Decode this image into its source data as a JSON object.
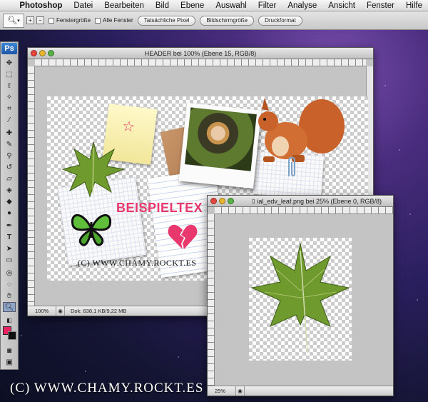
{
  "menubar": {
    "app_name": "Photoshop",
    "items": [
      "Datei",
      "Bearbeiten",
      "Bild",
      "Ebene",
      "Auswahl",
      "Filter",
      "Analyse",
      "Ansicht",
      "Fenster",
      "Hilfe"
    ]
  },
  "options_bar": {
    "tool_icon": "zoom-icon",
    "fenstergroesse_label": "Fenstergröße",
    "alle_fenster_label": "Alle Fenster",
    "btn_actual_pixels": "Tatsächliche Pixel",
    "btn_fit_screen": "Bildschirmgröße",
    "btn_print_size": "Druckformat"
  },
  "tools_panel": {
    "logo": "Ps",
    "foreground_color": "#e8235f",
    "background_color": "#111111"
  },
  "window_header": {
    "title": "HEADER bei 100% (Ebene 15, RGB/8)",
    "zoom": "100%",
    "doc_info": "Dok: 638,1 KB/9,22 MB",
    "canvas_text": "BEISPIELTEX",
    "url_text": "(C) WWW.CHAMY.ROCKT.ES"
  },
  "window_leaf": {
    "title": "ial_edv_leaf.png bei 25% (Ebene 0, RGB/8)",
    "zoom": "25%"
  },
  "watermark": "(C) WWW.CHAMY.ROCKT.ES",
  "colors": {
    "accent_pink": "#e8386e",
    "leaf_green": "#6f9a2e",
    "squirrel": "#c8612a"
  }
}
